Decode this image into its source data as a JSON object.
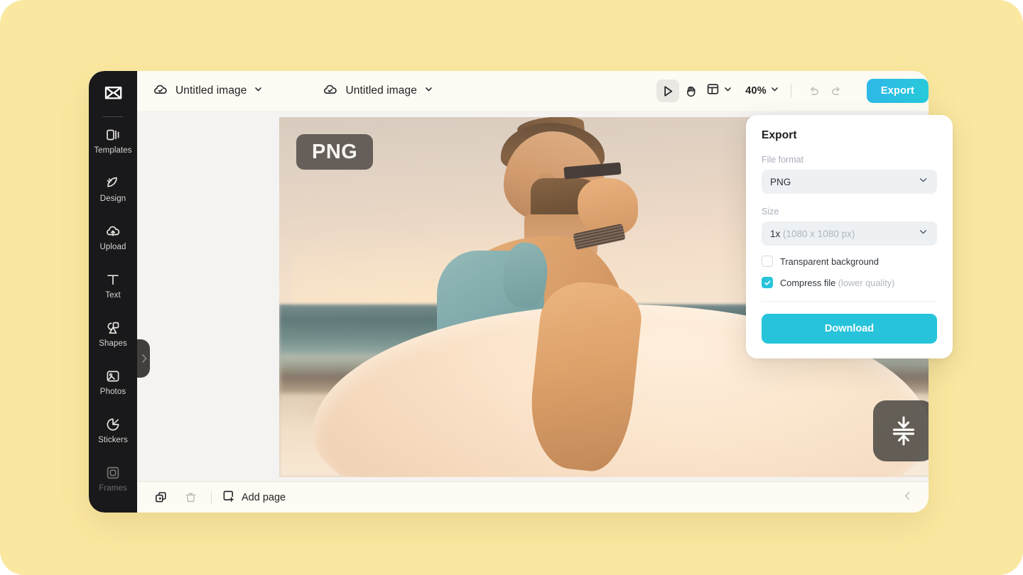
{
  "theme": {
    "backdrop": "#fbe8a0",
    "sidebar_bg": "#19181a",
    "toolbar_bg": "#fdfbf3",
    "canvas_bg": "#f4f3f1",
    "accent_cyan": "#27c3db",
    "export_gradient_from": "#2fb8e8",
    "export_gradient_to": "#27cada"
  },
  "sidebar": {
    "logo_name": "capcut-logo",
    "items": [
      {
        "label": "Templates",
        "icon": "templates-icon"
      },
      {
        "label": "Design",
        "icon": "design-icon"
      },
      {
        "label": "Upload",
        "icon": "upload-cloud-icon"
      },
      {
        "label": "Text",
        "icon": "text-icon"
      },
      {
        "label": "Shapes",
        "icon": "shapes-icon"
      },
      {
        "label": "Photos",
        "icon": "photos-icon"
      },
      {
        "label": "Stickers",
        "icon": "stickers-icon"
      },
      {
        "label": "Frames",
        "icon": "frames-icon"
      }
    ],
    "collapse_handle_icon": "chevron-right-icon"
  },
  "toolbar": {
    "file_one": {
      "name": "Untitled image",
      "cloud_icon": "cloud-check-icon",
      "chevron": "chevron-down-icon"
    },
    "file_two": {
      "name": "Untitled image",
      "cloud_icon": "cloud-check-icon",
      "chevron": "chevron-down-icon"
    },
    "tools": [
      {
        "name": "select-cursor-tool",
        "icon": "cursor-arrow-icon",
        "active": true
      },
      {
        "name": "hand-pan-tool",
        "icon": "hand-icon",
        "active": false
      }
    ],
    "layout_tool": {
      "icon": "layout-grid-icon",
      "chevron": "chevron-down-icon"
    },
    "zoom": {
      "value": "40%",
      "chevron": "chevron-down-icon"
    },
    "undo": {
      "icon": "undo-icon",
      "disabled": true
    },
    "redo": {
      "icon": "redo-icon",
      "disabled": true
    },
    "export_label": "Export"
  },
  "canvas": {
    "format_badge": "PNG",
    "compress_button_icon": "compress-vertical-icon",
    "image_description": "Bearded man in teal tank top with sunglasses carrying a surfboard at the beach during sunset"
  },
  "bottom_bar": {
    "duplicate_icon": "duplicate-page-icon",
    "delete_icon": "trash-icon",
    "add_page_label": "Add page",
    "add_page_icon": "add-page-icon",
    "collapse_icon": "chevron-left-icon"
  },
  "export_panel": {
    "title": "Export",
    "file_format": {
      "label": "File format",
      "value": "PNG",
      "chevron": "chevron-down-icon"
    },
    "size": {
      "label": "Size",
      "value_main": "1x",
      "value_detail": " (1080 x 1080 px)",
      "chevron": "chevron-down-icon"
    },
    "options": [
      {
        "label": "Transparent background",
        "hint": "",
        "checked": false
      },
      {
        "label": "Compress file",
        "hint": " (lower quality)",
        "checked": true
      }
    ],
    "download_label": "Download"
  }
}
